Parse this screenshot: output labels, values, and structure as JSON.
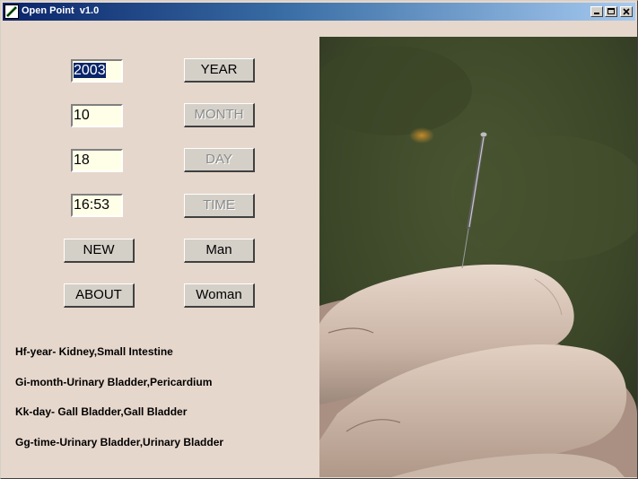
{
  "window": {
    "title": "Open Point  v1.0"
  },
  "fields": {
    "year": "2003",
    "month": "10",
    "day": "18",
    "time": "16:53"
  },
  "buttons": {
    "year": "YEAR",
    "month": "MONTH",
    "day": "DAY",
    "time": "TIME",
    "new": "NEW",
    "man": "Man",
    "about": "ABOUT",
    "woman": "Woman"
  },
  "info": {
    "year_line": "Hf-year- Kidney,Small Intestine",
    "month_line": "Gi-month-Urinary Bladder,Pericardium",
    "day_line": "Kk-day- Gall Bladder,Gall Bladder",
    "time_line": "Gg-time-Urinary Bladder,Urinary Bladder"
  },
  "icons": {
    "app": "needle-icon",
    "minimize": "minimize-icon",
    "maximize": "maximize-icon",
    "close": "close-icon"
  }
}
